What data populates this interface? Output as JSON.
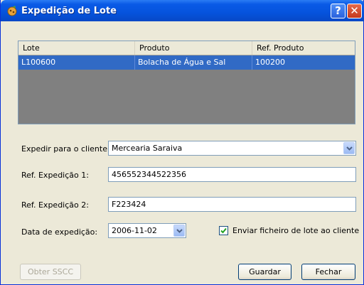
{
  "window": {
    "title": "Expedição de Lote",
    "help_label": "?",
    "close_label": "✕"
  },
  "grid": {
    "columns": [
      "Lote",
      "Produto",
      "Ref. Produto"
    ],
    "rows": [
      [
        "L100600",
        "Bolacha de Água e Sal",
        "100200"
      ]
    ]
  },
  "form": {
    "client_label": "Expedir para o cliente:",
    "client_value": "Mercearia Saraiva",
    "ref1_label": "Ref. Expedição 1:",
    "ref1_value": "456552344522356",
    "ref2_label": "Ref. Expedição 2:",
    "ref2_value": "F223424",
    "date_label": "Data de expedição:",
    "date_value": "2006-11-02",
    "send_file_label": "Enviar ficheiro de lote ao cliente",
    "send_file_checked": true
  },
  "buttons": {
    "sscc_label": "Obter SSCC",
    "save_label": "Guardar",
    "close_label": "Fechar"
  },
  "colors": {
    "titlebar": "#0553dd",
    "selection": "#316ac5",
    "grid_empty": "#808080"
  }
}
